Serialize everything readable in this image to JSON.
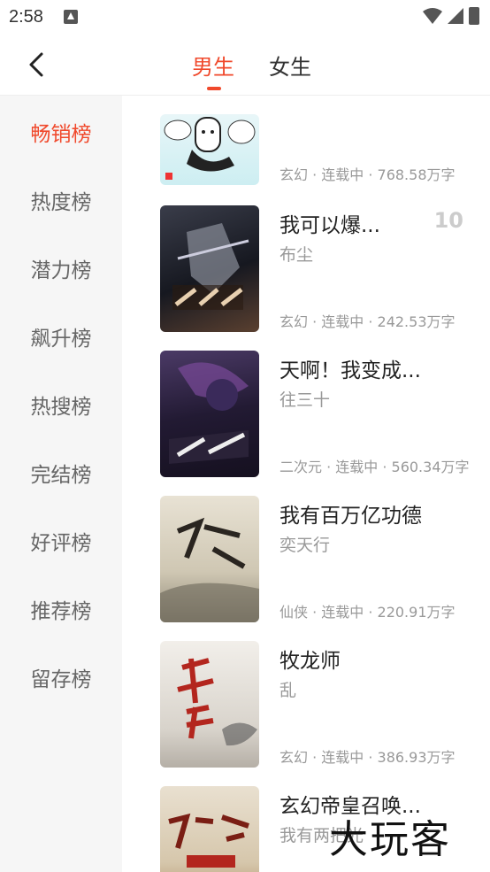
{
  "status": {
    "time": "2:58"
  },
  "header": {
    "tabs": [
      "男生",
      "女生"
    ],
    "active_tab": 0
  },
  "sidebar": {
    "items": [
      {
        "label": "畅销榜",
        "active": true
      },
      {
        "label": "热度榜"
      },
      {
        "label": "潜力榜"
      },
      {
        "label": "飙升榜"
      },
      {
        "label": "热搜榜"
      },
      {
        "label": "完结榜"
      },
      {
        "label": "好评榜"
      },
      {
        "label": "推荐榜"
      },
      {
        "label": "留存榜"
      }
    ]
  },
  "books": [
    {
      "title": "",
      "author": "",
      "meta": "玄幻 · 连载中 · 768.58万字",
      "rank": ""
    },
    {
      "title": "我可以爆...",
      "author": "布尘",
      "meta": "玄幻 · 连载中 · 242.53万字",
      "rank": "10"
    },
    {
      "title": "天啊！我变成...",
      "author": "往三十",
      "meta": "二次元 · 连载中 · 560.34万字",
      "rank": ""
    },
    {
      "title": "我有百万亿功德",
      "author": "奕天行",
      "meta": "仙侠 · 连载中 · 220.91万字",
      "rank": ""
    },
    {
      "title": "牧龙师",
      "author": "乱",
      "meta": "玄幻 · 连载中 · 386.93万字",
      "rank": ""
    },
    {
      "title": "玄幻帝皇召唤...",
      "author": "我有两把光",
      "meta": "",
      "rank": ""
    }
  ],
  "watermark": "大玩客",
  "colors": {
    "accent": "#f0492c"
  }
}
